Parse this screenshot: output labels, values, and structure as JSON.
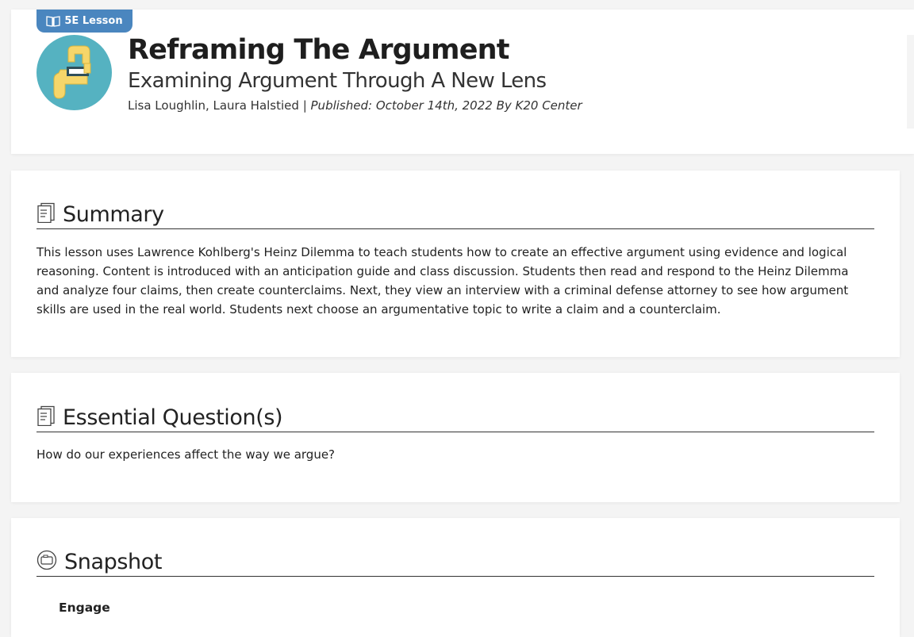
{
  "header": {
    "badge_label": "5E Lesson",
    "title": "Reframing The Argument",
    "subtitle": "Examining Argument Through A New Lens",
    "authors": "Lisa Loughlin, Laura Halstied",
    "separator": " | ",
    "published": "Published: October 14th, 2022 By K20 Center",
    "avatar_icon": "hands-frame-icon",
    "colors": {
      "badge": "#4a86bf",
      "avatar_bg": "#55b2c1",
      "hands": "#f6d66a"
    }
  },
  "summary": {
    "heading": "Summary",
    "icon": "document-icon",
    "text": "This lesson uses Lawrence Kohlberg's Heinz Dilemma to teach students how to create an effective argument using evidence and logical reasoning. Content is introduced with an anticipation guide and class discussion. Students then read and respond to the Heinz Dilemma and analyze four claims, then create counterclaims. Next, they view an interview with a criminal defense attorney to see how argument skills are used in the real world. Students next choose an argumentative topic to write a claim and a counterclaim."
  },
  "essential_questions": {
    "heading": "Essential Question(s)",
    "icon": "document-icon",
    "text": "How do our experiences affect the way we argue?"
  },
  "snapshot": {
    "heading": "Snapshot",
    "icon": "camera-icon",
    "first_phase": "Engage"
  }
}
